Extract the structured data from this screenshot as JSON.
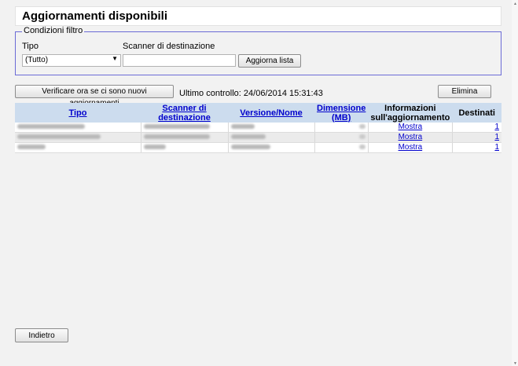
{
  "header": {
    "title": "Aggiornamenti disponibili"
  },
  "filter": {
    "legend": "Condizioni filtro",
    "type_label": "Tipo",
    "scanner_label": "Scanner di destinazione",
    "type_value": "(Tutto)",
    "scanner_value": "",
    "refresh_button": "Aggiorna lista"
  },
  "toolbar": {
    "check_button": "Verificare ora se ci sono nuovi aggiornamenti",
    "last_check": "Ultimo controllo: 24/06/2014 15:31:43",
    "delete_button": "Elimina"
  },
  "table": {
    "columns": {
      "type": "Tipo",
      "scanner_1": "Scanner di",
      "scanner_2": "destinazione",
      "version": "Versione/Nome",
      "size_1": "Dimensione",
      "size_2": "(MB)",
      "info_1": "Informazioni",
      "info_2": "sull'aggiornamento",
      "targets": "Destinati"
    },
    "rows": [
      {
        "info": "Mostra",
        "targets": "1"
      },
      {
        "info": "Mostra",
        "targets": "1"
      },
      {
        "info": "Mostra",
        "targets": "1"
      }
    ]
  },
  "footer": {
    "back_button": "Indietro"
  }
}
